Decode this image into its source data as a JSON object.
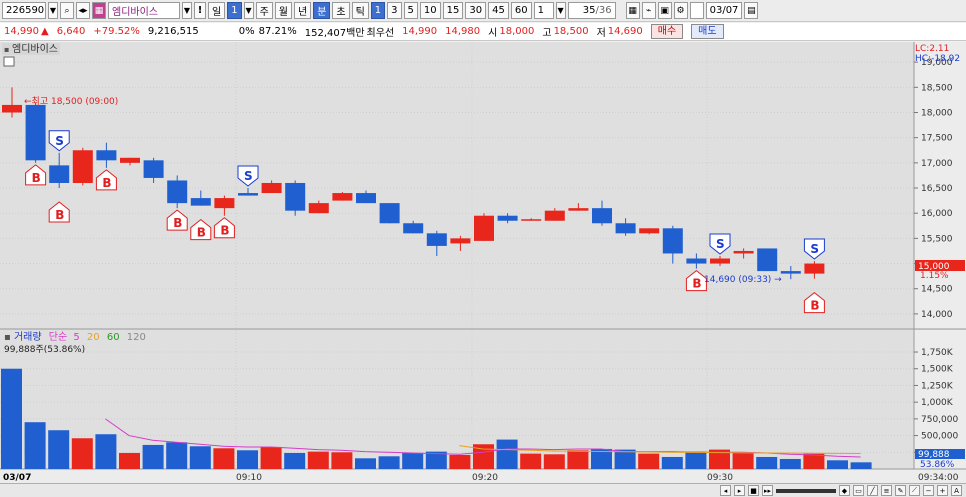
{
  "toolbar": {
    "code": "226590",
    "name": "엠디바이스",
    "alert": "!",
    "period_selected": "일",
    "period_num": "1",
    "periods": [
      "주",
      "월",
      "년",
      "분",
      "초",
      "틱"
    ],
    "minute_options": [
      "1",
      "3",
      "5",
      "10",
      "15",
      "30",
      "45",
      "60"
    ],
    "minute_selected": "1",
    "count_value": "1",
    "counter": "35",
    "counter_total": "/36",
    "date": "03/07"
  },
  "quote": {
    "price": "14,990",
    "change_arrow": "▲",
    "change": "6,640",
    "change_pct": "+79.52%",
    "volume": "9,216,515",
    "ratio": "0%",
    "ratio_pct": "87.21%",
    "amount": "152,407백만",
    "ask_label": "최우선",
    "ask": "14,990",
    "bid": "14,980",
    "open_label": "시",
    "open": "18,000",
    "high_label": "고",
    "high": "18,500",
    "low_label": "저",
    "low": "14,690",
    "buy_label": "매수",
    "sell_label": "매도"
  },
  "price_pane": {
    "title": "엠디바이스",
    "lc_label": "LC:2.11",
    "hc_label": "HC:-18.92",
    "y_ticks": [
      "19,000",
      "18,500",
      "18,000",
      "17,500",
      "17,000",
      "16,500",
      "16,000",
      "15,500",
      "15,000",
      "14,500",
      "14,000"
    ],
    "current_price_tag": "15,000",
    "current_pct_tag": "1.15%",
    "high_annotation": "최고 18,500 (09:00)",
    "low_annotation": "14,690 (09:33)"
  },
  "volume_pane": {
    "title": "거래량",
    "ma_label": "단순",
    "ma_periods": [
      "5",
      "20",
      "60",
      "120"
    ],
    "last_value": "99,888주(53.86%)",
    "y_ticks": [
      "1,750K",
      "1,500K",
      "1,250K",
      "1,000K",
      "750,000",
      "500,000",
      "250,000"
    ],
    "last_tag": "99,888",
    "last_pct_tag": "53.86%"
  },
  "x_axis": {
    "labels": [
      "03/07",
      "09:10",
      "09:20",
      "09:30"
    ],
    "right_time": "09:34:00"
  },
  "colors": {
    "up": "#e8261c",
    "down": "#1f5fcf",
    "ma5": "#d63cc8",
    "ma20": "#e8a020"
  },
  "chart_data": {
    "type": "candlestick",
    "y_range": [
      13700,
      19400
    ],
    "candles": [
      {
        "o": 18000,
        "h": 18500,
        "l": 17900,
        "c": 18150
      },
      {
        "o": 18150,
        "h": 18200,
        "l": 17000,
        "c": 17050
      },
      {
        "o": 16950,
        "h": 17200,
        "l": 16500,
        "c": 16600
      },
      {
        "o": 16600,
        "h": 17300,
        "l": 16550,
        "c": 17250
      },
      {
        "o": 17250,
        "h": 17400,
        "l": 16900,
        "c": 17050
      },
      {
        "o": 17000,
        "h": 17100,
        "l": 16950,
        "c": 17100
      },
      {
        "o": 17050,
        "h": 17100,
        "l": 16600,
        "c": 16700
      },
      {
        "o": 16650,
        "h": 16750,
        "l": 16100,
        "c": 16200
      },
      {
        "o": 16300,
        "h": 16450,
        "l": 16150,
        "c": 16150
      },
      {
        "o": 16100,
        "h": 16350,
        "l": 15950,
        "c": 16300
      },
      {
        "o": 16400,
        "h": 16500,
        "l": 16350,
        "c": 16350
      },
      {
        "o": 16400,
        "h": 16650,
        "l": 16400,
        "c": 16600
      },
      {
        "o": 16600,
        "h": 16650,
        "l": 15950,
        "c": 16050
      },
      {
        "o": 16000,
        "h": 16250,
        "l": 16000,
        "c": 16200
      },
      {
        "o": 16250,
        "h": 16420,
        "l": 16250,
        "c": 16400
      },
      {
        "o": 16400,
        "h": 16450,
        "l": 16200,
        "c": 16200
      },
      {
        "o": 16200,
        "h": 16200,
        "l": 15800,
        "c": 15800
      },
      {
        "o": 15800,
        "h": 15850,
        "l": 15600,
        "c": 15600
      },
      {
        "o": 15600,
        "h": 15650,
        "l": 15150,
        "c": 15350
      },
      {
        "o": 15400,
        "h": 15550,
        "l": 15250,
        "c": 15500
      },
      {
        "o": 15450,
        "h": 16000,
        "l": 15450,
        "c": 15950
      },
      {
        "o": 15950,
        "h": 16000,
        "l": 15800,
        "c": 15850
      },
      {
        "o": 15850,
        "h": 15900,
        "l": 15850,
        "c": 15880
      },
      {
        "o": 15850,
        "h": 16100,
        "l": 15850,
        "c": 16050
      },
      {
        "o": 16050,
        "h": 16200,
        "l": 16050,
        "c": 16100
      },
      {
        "o": 16100,
        "h": 16250,
        "l": 15750,
        "c": 15800
      },
      {
        "o": 15800,
        "h": 15900,
        "l": 15550,
        "c": 15600
      },
      {
        "o": 15600,
        "h": 15700,
        "l": 15580,
        "c": 15700
      },
      {
        "o": 15700,
        "h": 15750,
        "l": 15000,
        "c": 15200
      },
      {
        "o": 15100,
        "h": 15200,
        "l": 14900,
        "c": 15000
      },
      {
        "o": 15000,
        "h": 15150,
        "l": 14950,
        "c": 15100
      },
      {
        "o": 15200,
        "h": 15300,
        "l": 15100,
        "c": 15250
      },
      {
        "o": 15300,
        "h": 15300,
        "l": 14850,
        "c": 14850
      },
      {
        "o": 14850,
        "h": 14950,
        "l": 14690,
        "c": 14800
      },
      {
        "o": 14800,
        "h": 15050,
        "l": 14700,
        "c": 15000
      }
    ],
    "volumes": [
      1500000,
      700000,
      580000,
      460000,
      520000,
      240000,
      360000,
      400000,
      340000,
      310000,
      280000,
      330000,
      240000,
      260000,
      250000,
      160000,
      190000,
      240000,
      260000,
      210000,
      370000,
      440000,
      230000,
      220000,
      280000,
      300000,
      290000,
      230000,
      180000,
      260000,
      290000,
      240000,
      180000,
      150000,
      230000,
      130000,
      99888
    ],
    "volume_y_range": [
      0,
      1900000
    ],
    "ma5_volume": [
      null,
      null,
      null,
      null,
      750000,
      500000,
      430000,
      400000,
      370000,
      340000,
      330000,
      330000,
      310000,
      290000,
      280000,
      260000,
      250000,
      240000,
      230000,
      220000,
      250000,
      300000,
      300000,
      290000,
      300000,
      300000,
      260000,
      260000,
      260000,
      250000,
      250000,
      250000,
      240000,
      220000,
      210000,
      190000,
      180000
    ],
    "ma20_volume": [
      null,
      null,
      null,
      null,
      null,
      null,
      null,
      null,
      null,
      null,
      null,
      null,
      null,
      null,
      null,
      null,
      null,
      null,
      null,
      350000,
      300000,
      290000,
      280000,
      270000,
      265000,
      262000,
      258000,
      255000,
      250000,
      248000,
      245000,
      242000,
      240000,
      238000,
      236000,
      234000,
      232000
    ],
    "signals": [
      {
        "i": 1,
        "t": "B"
      },
      {
        "i": 2,
        "t": "S"
      },
      {
        "i": 2,
        "t": "B",
        "low": true
      },
      {
        "i": 4,
        "t": "B"
      },
      {
        "i": 7,
        "t": "B"
      },
      {
        "i": 8,
        "t": "B",
        "low": true
      },
      {
        "i": 9,
        "t": "B"
      },
      {
        "i": 10,
        "t": "S"
      },
      {
        "i": 29,
        "t": "B"
      },
      {
        "i": 30,
        "t": "S"
      },
      {
        "i": 34,
        "t": "S"
      },
      {
        "i": 34,
        "t": "B",
        "low": true
      }
    ]
  }
}
